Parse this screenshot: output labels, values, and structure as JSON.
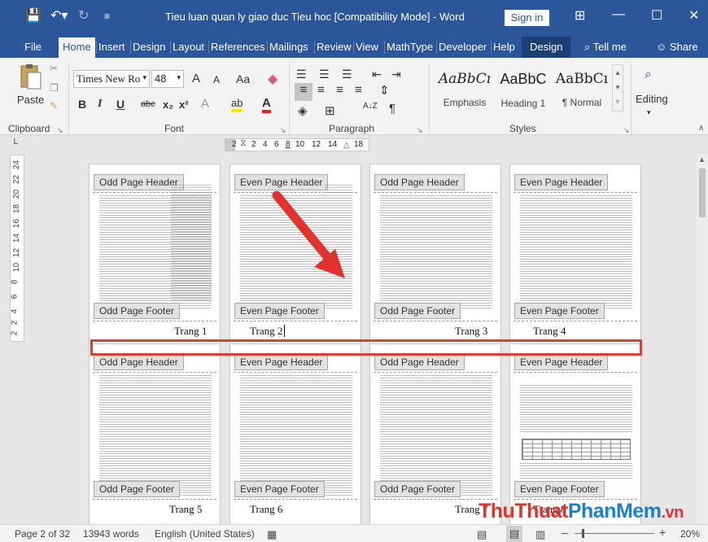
{
  "titlebar": {
    "title": "Tieu luan quan ly giao duc Tieu hoc [Compatibility Mode]  -  Word",
    "sign_in": "Sign in",
    "save_icon": "save-icon",
    "undo_icon": "undo-icon",
    "redo_icon": "redo-icon",
    "customize_icon": "customize-qat-icon",
    "ribbon_display_icon": "ribbon-display-options-icon",
    "minimize_icon": "minimize-icon",
    "restore_icon": "restore-icon",
    "close_icon": "close-icon"
  },
  "tabs": [
    "File",
    "Home",
    "Insert",
    "Design",
    "Layout",
    "References",
    "Mailings",
    "Review",
    "View",
    "MathType",
    "Developer",
    "Help",
    "Design"
  ],
  "tell_me": "Tell me",
  "share": "Share",
  "ribbon": {
    "clipboard": {
      "label": "Clipboard",
      "paste": "Paste"
    },
    "font": {
      "label": "Font",
      "family": "Times New Ro",
      "size": "48",
      "grow": "A",
      "shrink": "A",
      "change_case": "Aa",
      "bold": "B",
      "italic": "I",
      "underline": "U",
      "strike": "abc",
      "subscript": "x₂",
      "superscript": "x²",
      "text_effects": "A",
      "highlight": "ab",
      "font_color": "A"
    },
    "paragraph": {
      "label": "Paragraph",
      "sort": "A↓Z",
      "pilcrow": "¶"
    },
    "styles": {
      "label": "Styles",
      "items": [
        {
          "sample": "AaBbCı",
          "name": "Emphasis"
        },
        {
          "sample": "AaBbC",
          "name": "Heading 1"
        },
        {
          "sample": "AaBbCı",
          "name": "¶ Normal"
        }
      ]
    },
    "editing": {
      "label": "Editing"
    }
  },
  "ruler": {
    "ticks": [
      "2",
      "2",
      "4",
      "6",
      "8",
      "10",
      "12",
      "14",
      "18"
    ]
  },
  "vruler": {
    "ticks": [
      "24",
      "22",
      "20",
      "18",
      "16",
      "14",
      "12",
      "10",
      "8",
      "6",
      "4",
      "2",
      "2"
    ]
  },
  "pages": [
    {
      "header": "Odd Page Header",
      "footer": "Odd Page Footer",
      "number": "Trang 1"
    },
    {
      "header": "Even Page Header",
      "footer": "Even Page Footer",
      "number": "Trang 2"
    },
    {
      "header": "Odd Page Header",
      "footer": "Odd Page Footer",
      "number": "Trang 3"
    },
    {
      "header": "Even Page Header",
      "footer": "Even Page Footer",
      "number": "Trang 4"
    },
    {
      "header": "Odd Page Header",
      "footer": "Odd Page Footer",
      "number": "Trang 5"
    },
    {
      "header": "Even Page Header",
      "footer": "Even Page Footer",
      "number": "Trang 6"
    },
    {
      "header": "Odd Page Header",
      "footer": "Odd Page Footer",
      "number": "Trang 7"
    },
    {
      "header": "Even Page Header",
      "footer": "Even Page Footer",
      "number": "Trang 8"
    }
  ],
  "statusbar": {
    "page": "Page 2 of 32",
    "words": "13943 words",
    "language": "English (United States)",
    "zoom_out": "–",
    "zoom_in": "+",
    "zoom": "20%"
  },
  "watermark": {
    "part1": "ThuThuat",
    "part2": "PhanMem",
    "part3": ".vn"
  },
  "colors": {
    "brand": "#2b579a",
    "highlight": "#d9403b",
    "watermark_red": "#e0332e",
    "watermark_blue": "#1e7fc9"
  }
}
